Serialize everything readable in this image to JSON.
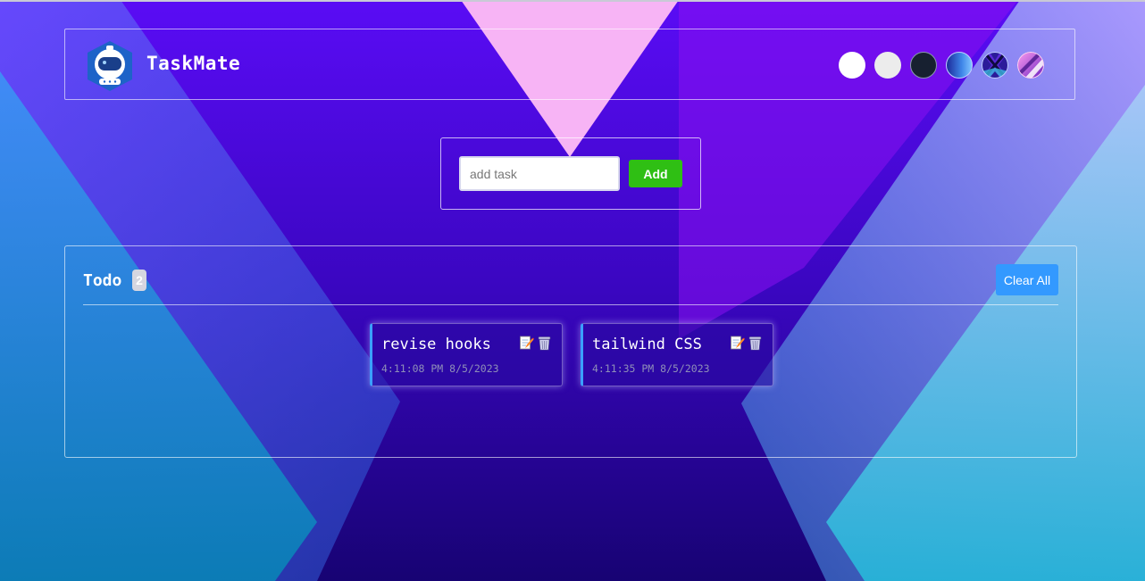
{
  "app": {
    "title": "TaskMate",
    "logo_icon": "astronaut-logo-icon"
  },
  "themes": [
    {
      "name": "white-theme",
      "color": "#ffffff"
    },
    {
      "name": "light-gray-theme",
      "color": "#ececec"
    },
    {
      "name": "dark-theme",
      "color": "#172030"
    },
    {
      "name": "blue-gradient-theme",
      "color": "#3b6fd8"
    },
    {
      "name": "x-pattern-theme",
      "color": "#2a1a8a"
    },
    {
      "name": "pink-stripe-theme",
      "color": "#e04fd0"
    }
  ],
  "add_task": {
    "placeholder": "add task",
    "value": "",
    "button_label": "Add",
    "button_color": "#2fbf14"
  },
  "todo": {
    "title": "Todo",
    "count": "2",
    "clear_label": "Clear All",
    "clear_color": "#3399ff",
    "tasks": [
      {
        "name": "revise hooks",
        "time": "4:11:08 PM 8/5/2023",
        "edit_icon": "edit-icon",
        "delete_icon": "trash-icon"
      },
      {
        "name": "tailwind CSS",
        "time": "4:11:35 PM 8/5/2023",
        "edit_icon": "edit-icon",
        "delete_icon": "trash-icon"
      }
    ]
  },
  "colors": {
    "background_top": "#4a0ee0",
    "background_bottom": "#1b0680",
    "accent_pink": "#f7b4f5",
    "accent_cyan": "#3ec6e8"
  }
}
